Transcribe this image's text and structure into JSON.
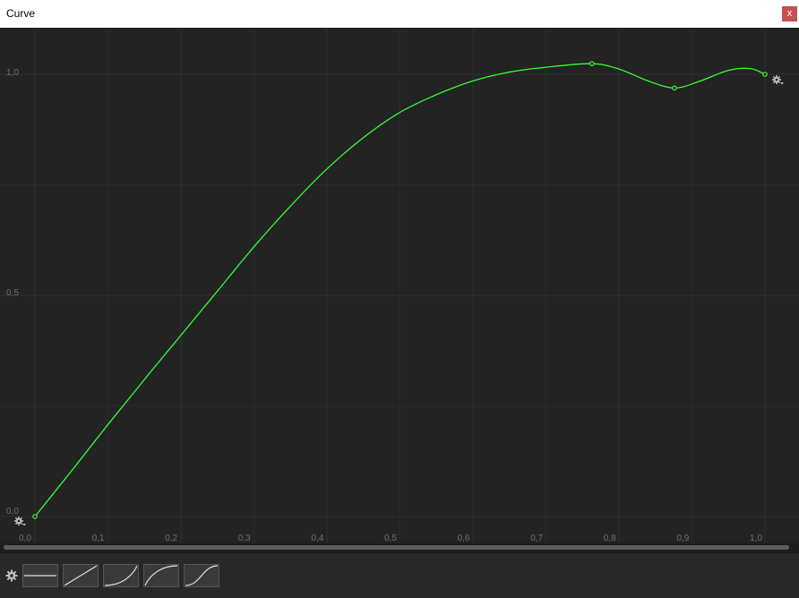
{
  "window": {
    "title": "Curve",
    "close_label": "x"
  },
  "colors": {
    "background": "#232323",
    "curve": "#33ff33",
    "grid_major": "#2f2f2f",
    "grid_minor": "#2a2a2a",
    "label": "#6e6e6e"
  },
  "editor": {
    "x_ticks": [
      "0,0",
      "0,1",
      "0,2",
      "0,3",
      "0,4",
      "0,5",
      "0,6",
      "0,7",
      "0,8",
      "0,9",
      "1,0"
    ],
    "y_ticks": [
      "0,0",
      "0,5",
      "1,0"
    ],
    "start_key_menu_icon": "gear-dropdown-icon",
    "end_key_menu_icon": "gear-dropdown-icon"
  },
  "chart_data": {
    "type": "line",
    "xlim": [
      0.0,
      1.0
    ],
    "ylim": [
      0.0,
      1.0
    ],
    "grid": true,
    "keys": [
      {
        "x": 0.0,
        "y": 0.0
      },
      {
        "x": 0.763,
        "y": 1.024
      },
      {
        "x": 0.876,
        "y": 0.969
      },
      {
        "x": 1.0,
        "y": 1.0
      }
    ],
    "points": [
      [
        0.0,
        0.0
      ],
      [
        0.05,
        0.103
      ],
      [
        0.1,
        0.208
      ],
      [
        0.15,
        0.31
      ],
      [
        0.2,
        0.41
      ],
      [
        0.25,
        0.51
      ],
      [
        0.3,
        0.61
      ],
      [
        0.35,
        0.702
      ],
      [
        0.4,
        0.786
      ],
      [
        0.45,
        0.857
      ],
      [
        0.5,
        0.914
      ],
      [
        0.55,
        0.954
      ],
      [
        0.6,
        0.985
      ],
      [
        0.65,
        1.005
      ],
      [
        0.7,
        1.016
      ],
      [
        0.763,
        1.024
      ],
      [
        0.8,
        1.012
      ],
      [
        0.84,
        0.985
      ],
      [
        0.876,
        0.969
      ],
      [
        0.91,
        0.984
      ],
      [
        0.95,
        1.009
      ],
      [
        0.98,
        1.013
      ],
      [
        1.0,
        1.0
      ]
    ]
  },
  "presets": [
    {
      "name": "constant",
      "icon": "preset-constant-icon"
    },
    {
      "name": "linear",
      "icon": "preset-linear-icon"
    },
    {
      "name": "ease-in",
      "icon": "preset-ease-in-icon"
    },
    {
      "name": "ease-out",
      "icon": "preset-ease-out-icon"
    },
    {
      "name": "ease-in-out",
      "icon": "preset-ease-in-out-icon"
    }
  ],
  "presets_menu_icon": "gear-icon"
}
